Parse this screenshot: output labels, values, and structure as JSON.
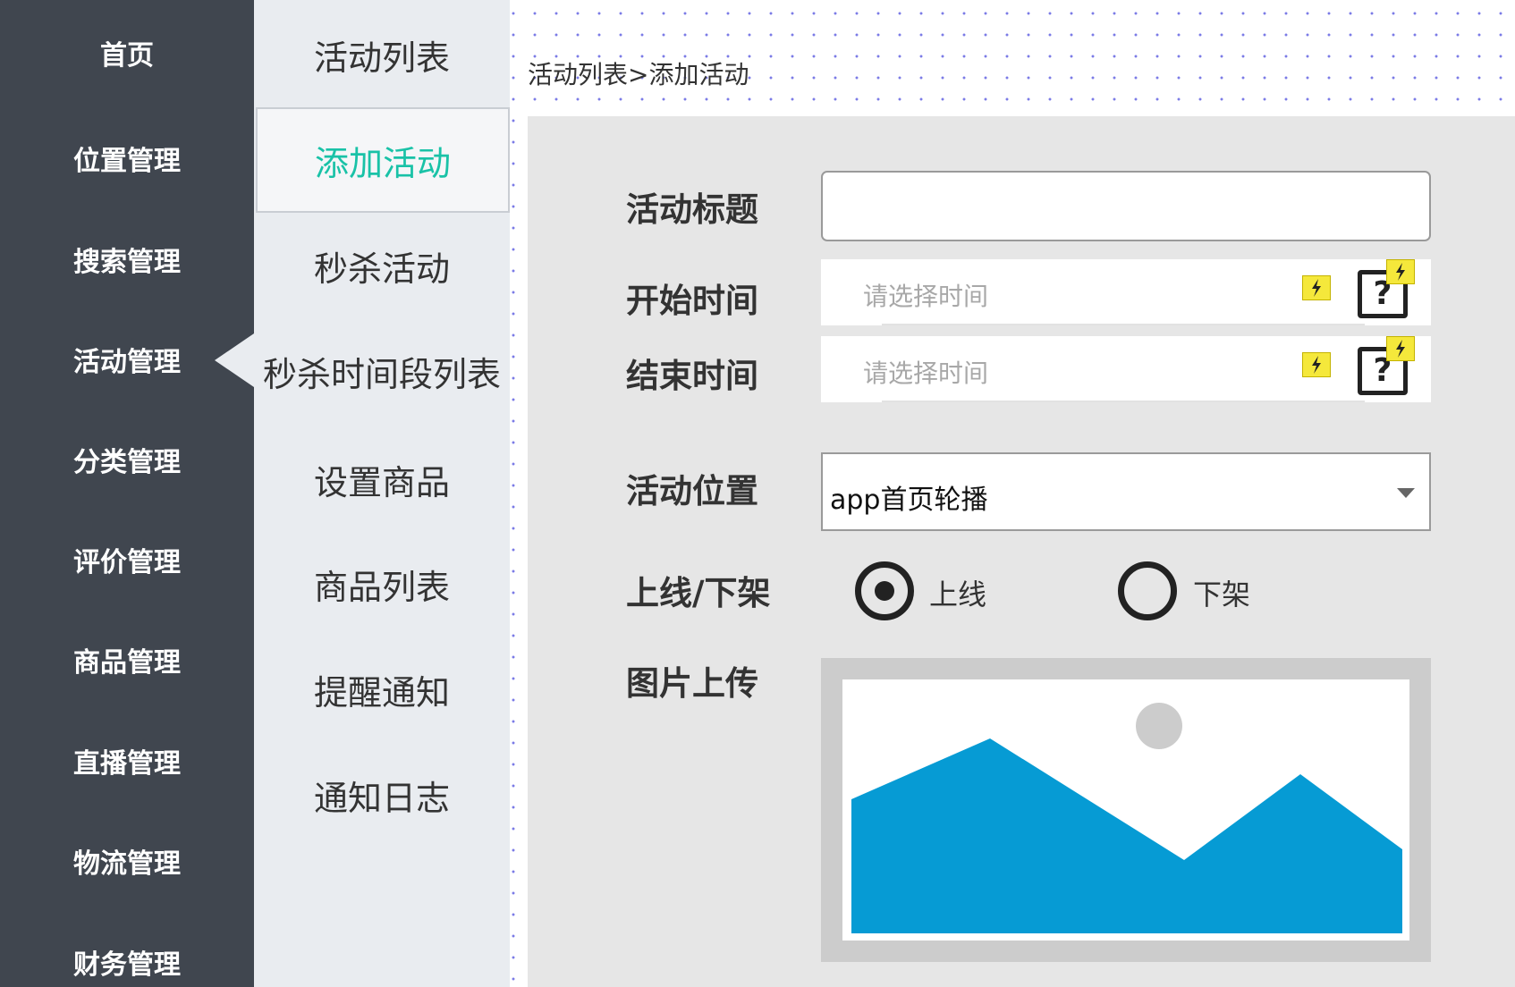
{
  "sidebar": {
    "items": [
      {
        "label": "首页"
      },
      {
        "label": "位置管理"
      },
      {
        "label": "搜索管理"
      },
      {
        "label": "活动管理"
      },
      {
        "label": "分类管理"
      },
      {
        "label": "评价管理"
      },
      {
        "label": "商品管理"
      },
      {
        "label": "直播管理"
      },
      {
        "label": "物流管理"
      },
      {
        "label": "财务管理"
      }
    ],
    "active_item": "活动管理"
  },
  "submenu": {
    "items": [
      {
        "label": "活动列表"
      },
      {
        "label": "添加活动"
      },
      {
        "label": "秒杀活动"
      },
      {
        "label": "秒杀时间段列表"
      },
      {
        "label": "设置商品"
      },
      {
        "label": "商品列表"
      },
      {
        "label": "提醒通知"
      },
      {
        "label": "通知日志"
      }
    ],
    "active_item": "添加活动"
  },
  "breadcrumb": "活动列表>添加活动",
  "form": {
    "title_label": "活动标题",
    "title_value": "",
    "start_label": "开始时间",
    "start_placeholder": "请选择时间",
    "end_label": "结束时间",
    "end_placeholder": "请选择时间",
    "position_label": "活动位置",
    "position_value": "app首页轮播",
    "status_label": "上线/下架",
    "status_options": [
      "上线",
      "下架"
    ],
    "status_selected": "上线",
    "image_label": "图片上传",
    "help_glyph": "?"
  },
  "icons": {
    "bolt": "lightning-bolt-icon",
    "help": "help-question-icon",
    "dropdown": "chevron-down-icon",
    "image": "image-placeholder-icon"
  },
  "colors": {
    "sidebar_bg": "#40464f",
    "submenu_bg": "#e9ecf0",
    "active_accent": "#19c2a7",
    "panel_bg": "#e6e6e6",
    "image_mountain": "#069bd4",
    "image_sun": "#cccccc",
    "bolt_yellow": "#f5e83b"
  }
}
